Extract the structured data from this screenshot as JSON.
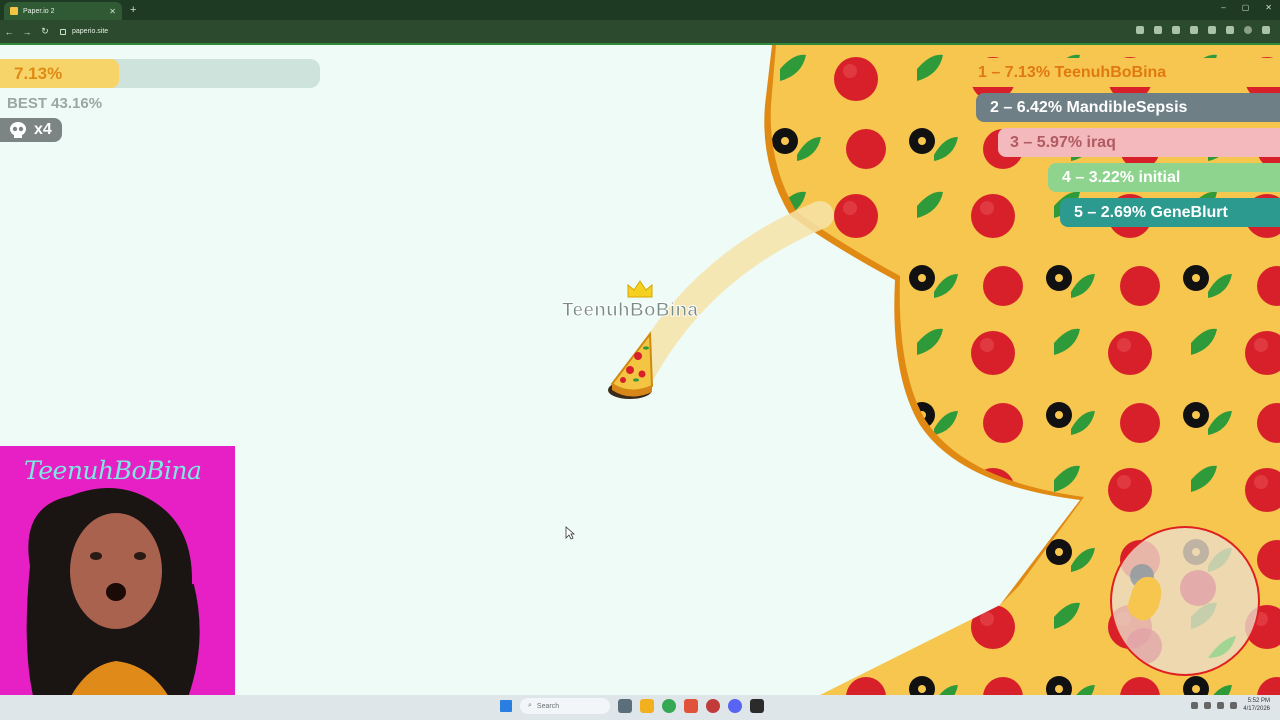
{
  "browser": {
    "tab_title": "Paper.io 2",
    "url": "paperio.site"
  },
  "hud": {
    "progress_label": "7.13%",
    "progress_fraction": 0.0713,
    "best_label": "BEST 43.16%",
    "kills_label": "x4"
  },
  "leaderboard": [
    {
      "text": "1 – 7.13% TeenuhBoBina"
    },
    {
      "text": "2 – 6.42% MandibleSepsis"
    },
    {
      "text": "3 – 5.97% iraq"
    },
    {
      "text": "4 – 3.22% initial"
    },
    {
      "text": "5 – 2.69% GeneBlurt"
    }
  ],
  "player": {
    "name": "TeenuhBoBina",
    "skin": "pizza-slice",
    "territory_pattern": "pepperoni-pizza"
  },
  "webcam": {
    "overlay_name": "TeenuhBoBina"
  },
  "taskbar": {
    "search_placeholder": "Search",
    "time": "5:52 PM",
    "date": "4/17/2026"
  },
  "colors": {
    "territory_crust": "#f7c64f",
    "territory_edge": "#e08a14",
    "pepperoni": "#d8202a",
    "basil": "#2e9a3a",
    "background": "#eefbf6",
    "webcam_bg": "#e620c4"
  },
  "icons": {
    "kills": "skull-icon",
    "crown": "crown-icon",
    "minimap": "minimap"
  }
}
